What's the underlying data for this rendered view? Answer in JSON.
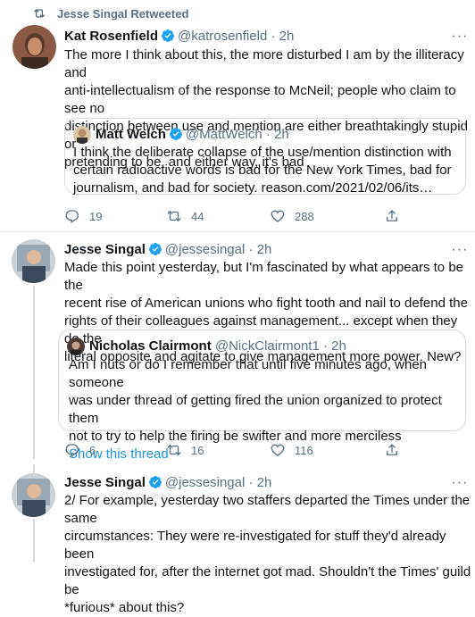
{
  "retweet_label": "Jesse Singal Retweeted",
  "tweets": [
    {
      "name": "Kat Rosenfield",
      "handle": "@katrosenfield",
      "time": "2h",
      "lines": [
        "The more I think about this, the more disturbed I am by the illiteracy and",
        "anti-intellectualism of the response to McNeil; people who claim to see no",
        "distinction between use and mention are either breathtakingly stupid or",
        "pretending to be, and either way, it's bad"
      ],
      "quote": {
        "name": "Matt Welch",
        "handle": "@MattWelch",
        "time": "2h",
        "lines": [
          "I think the deliberate collapse of the use/mention distinction with",
          "certain radioactive words is bad for the New York Times, bad for",
          "journalism, and bad for society. reason.com/2021/02/06/its…"
        ]
      },
      "replies": "19",
      "retweets": "44",
      "likes": "288"
    },
    {
      "name": "Jesse Singal",
      "handle": "@jessesingal",
      "time": "2h",
      "lines": [
        "Made this point yesterday, but I'm fascinated by what appears to be the",
        "recent rise of American unions who fight tooth and nail to defend the",
        "rights of their colleagues against management... except when they do the",
        "literal opposite and agitate to give management more power. New?"
      ],
      "quote": {
        "name": "Nicholas Clairmont",
        "handle": "@NickClairmont1",
        "time": "2h",
        "lines": [
          "Am I nuts or do I remember that until five minutes ago, when someone",
          "was under thread of getting fired the union organized to protect them",
          "not to try to help the firing be swifter and more merciless"
        ],
        "show_thread": "Show this thread"
      },
      "replies": "6",
      "retweets": "16",
      "likes": "116"
    },
    {
      "name": "Jesse Singal",
      "handle": "@jessesingal",
      "time": "2h",
      "lines": [
        "2/ For example, yesterday two staffers departed the Times under the same",
        "circumstances: They were re-investigated for stuff they'd already been",
        "investigated for, after the internet got mad. Shouldn't the Times' guild be",
        "*furious* about this?"
      ]
    }
  ],
  "colors": {
    "accent": "#1da1f2",
    "link": "#1b95e0",
    "muted": "#5b7083",
    "border": "#e6ecf0"
  }
}
